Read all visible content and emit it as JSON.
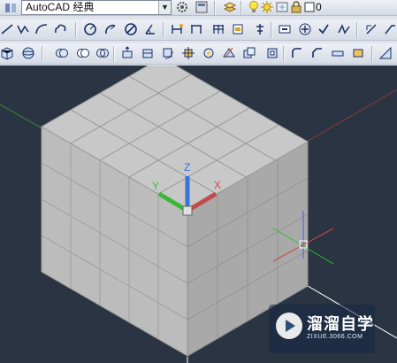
{
  "toolbar": {
    "workspace_value": "AutoCAD 经典",
    "current_layer": "0"
  },
  "icons": {
    "row1": [
      "gear-icon",
      "workspace-settings-icon",
      "layer-properties-icon",
      "lightbulb-icon",
      "sun-icon",
      "color-square-icon",
      "lock-icon"
    ],
    "row2": [
      "line-icon",
      "polyline-icon",
      "arc-icon",
      "circle-icon",
      "revision-cloud-icon",
      "hatch-icon",
      "dimension-icon",
      "ordinate-icon",
      "angular-dimension-icon",
      "tolerance-icon",
      "center-mark-icon",
      "inspect-icon",
      "multileader-icon"
    ],
    "row3": [
      "box-icon",
      "sphere-icon",
      "cylinder-icon",
      "union-icon",
      "subtract-icon",
      "extrude-icon",
      "revolve-icon",
      "3d-move-icon",
      "3d-rotate-icon",
      "slice-icon",
      "section-icon",
      "shell-icon",
      "render-icon"
    ]
  },
  "ucs_icon": {
    "x_label": "X",
    "y_label": "Y",
    "z_label": "Z"
  },
  "watermark": {
    "title": "溜溜自学",
    "subtitle": "ZIXUE.3066.COM"
  },
  "colors": {
    "background": "#2b3442",
    "top_face": "#c9c9c9",
    "left_face": "#bababa",
    "right_face": "#a8a8a8",
    "axis_x": "#d04848",
    "axis_y": "#38c038",
    "axis_z": "#3a72d8"
  }
}
